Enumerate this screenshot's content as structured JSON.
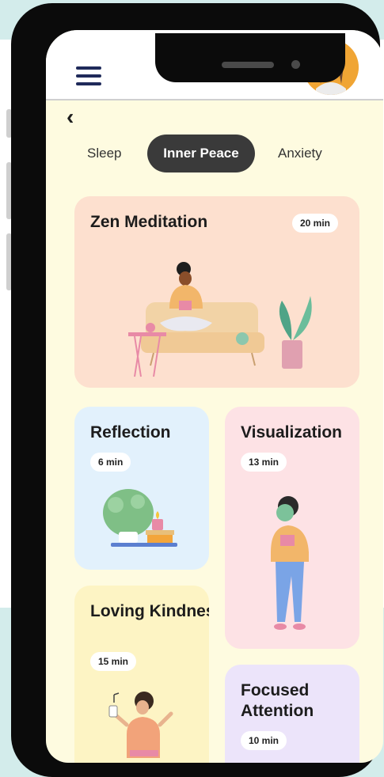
{
  "tabs": [
    {
      "label": "Sleep",
      "active": false
    },
    {
      "label": "Inner Peace",
      "active": true
    },
    {
      "label": "Anxiety",
      "active": false
    }
  ],
  "cards": [
    {
      "title": "Zen Meditation",
      "duration": "20 min",
      "color": "#fde0cf"
    },
    {
      "title": "Reflection",
      "duration": "6 min",
      "color": "#e2f1fc"
    },
    {
      "title": "Visualization",
      "duration": "13 min",
      "color": "#fde2e5"
    },
    {
      "title": "Loving Kindness",
      "duration": "15 min",
      "color": "#fdf4c4"
    },
    {
      "title": "Focused Attention",
      "duration": "10 min",
      "color": "#ece4fa"
    }
  ],
  "icons": {
    "menu": "hamburger-menu-icon",
    "back": "chevron-left-icon",
    "back_glyph": "‹",
    "avatar": "user-avatar"
  },
  "colors": {
    "accent_dark": "#3a3a3a",
    "menu_navy": "#1f2a5a",
    "screen_bg": "#fefbe0",
    "outer_teal": "#d3eceb"
  }
}
